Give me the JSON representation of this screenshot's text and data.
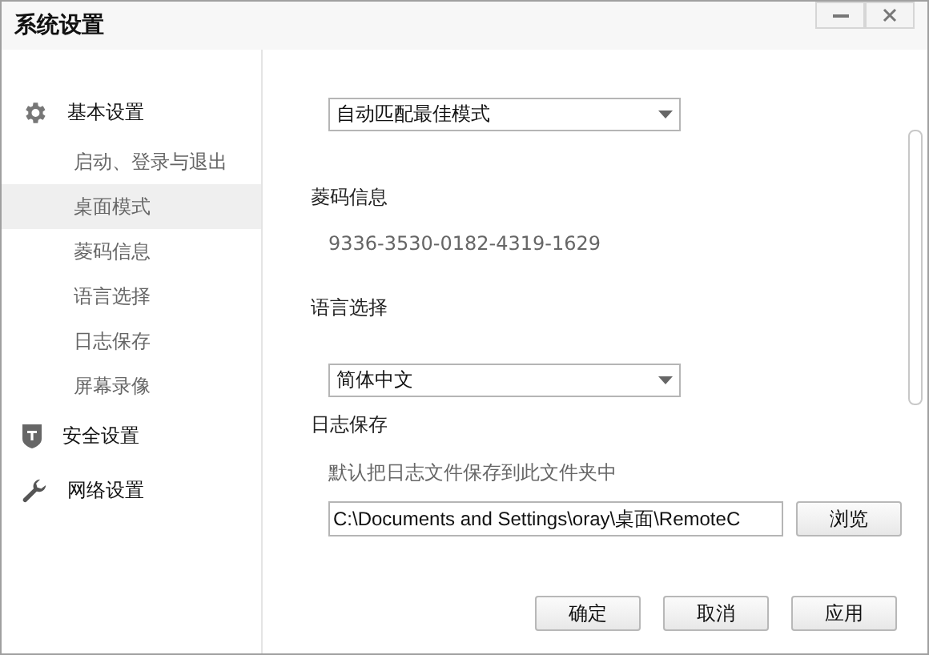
{
  "window": {
    "title": "系统设置"
  },
  "sidebar": {
    "groups": [
      {
        "label": "基本设置",
        "kind": "gear",
        "children": [
          {
            "label": "启动、登录与退出",
            "selected": false
          },
          {
            "label": "桌面模式",
            "selected": true
          },
          {
            "label": "菱码信息",
            "selected": false
          },
          {
            "label": "语言选择",
            "selected": false
          },
          {
            "label": "日志保存",
            "selected": false
          },
          {
            "label": "屏幕录像",
            "selected": false
          }
        ]
      },
      {
        "label": "安全设置",
        "kind": "shield"
      },
      {
        "label": "网络设置",
        "kind": "wrench"
      }
    ]
  },
  "content": {
    "desktop_mode": {
      "value": "自动匹配最佳模式"
    },
    "code_info": {
      "heading": "菱码信息",
      "code": "9336-3530-0182-4319-1629"
    },
    "language": {
      "heading": "语言选择",
      "value": "简体中文"
    },
    "log": {
      "heading": "日志保存",
      "description": "默认把日志文件保存到此文件夹中",
      "path": "C:\\Documents and Settings\\oray\\桌面\\RemoteC",
      "browse": "浏览"
    }
  },
  "buttons": [
    "确定",
    "取消",
    "应用"
  ]
}
